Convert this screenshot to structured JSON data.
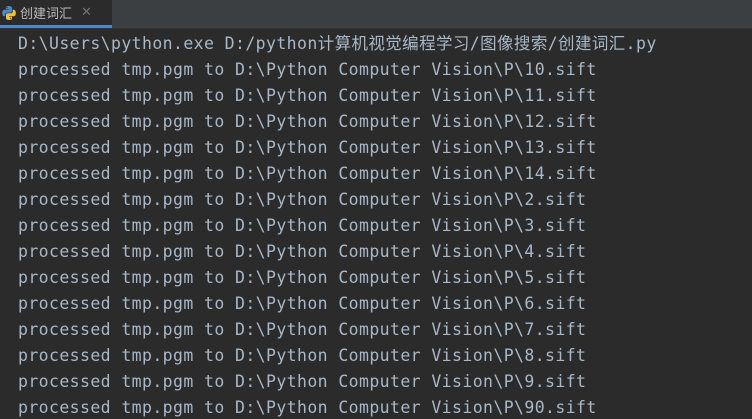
{
  "tab": {
    "icon": "python-file-icon",
    "label": "创建词汇",
    "close_icon": "close-icon",
    "close_glyph": "✕"
  },
  "console": {
    "command_line": "D:\\Users\\python.exe D:/python计算机视觉编程学习/图像搜索/创建词汇.py",
    "output_lines": [
      "processed tmp.pgm to D:\\Python Computer Vision\\P\\10.sift",
      "processed tmp.pgm to D:\\Python Computer Vision\\P\\11.sift",
      "processed tmp.pgm to D:\\Python Computer Vision\\P\\12.sift",
      "processed tmp.pgm to D:\\Python Computer Vision\\P\\13.sift",
      "processed tmp.pgm to D:\\Python Computer Vision\\P\\14.sift",
      "processed tmp.pgm to D:\\Python Computer Vision\\P\\2.sift",
      "processed tmp.pgm to D:\\Python Computer Vision\\P\\3.sift",
      "processed tmp.pgm to D:\\Python Computer Vision\\P\\4.sift",
      "processed tmp.pgm to D:\\Python Computer Vision\\P\\5.sift",
      "processed tmp.pgm to D:\\Python Computer Vision\\P\\6.sift",
      "processed tmp.pgm to D:\\Python Computer Vision\\P\\7.sift",
      "processed tmp.pgm to D:\\Python Computer Vision\\P\\8.sift",
      "processed tmp.pgm to D:\\Python Computer Vision\\P\\9.sift",
      "processed tmp.pgm to D:\\Python Computer Vision\\P\\90.sift"
    ]
  },
  "colors": {
    "background": "#2b2b2b",
    "tabbar": "#3c3f41",
    "text": "#a9b7c6",
    "tab_accent": "#4a88c7"
  }
}
